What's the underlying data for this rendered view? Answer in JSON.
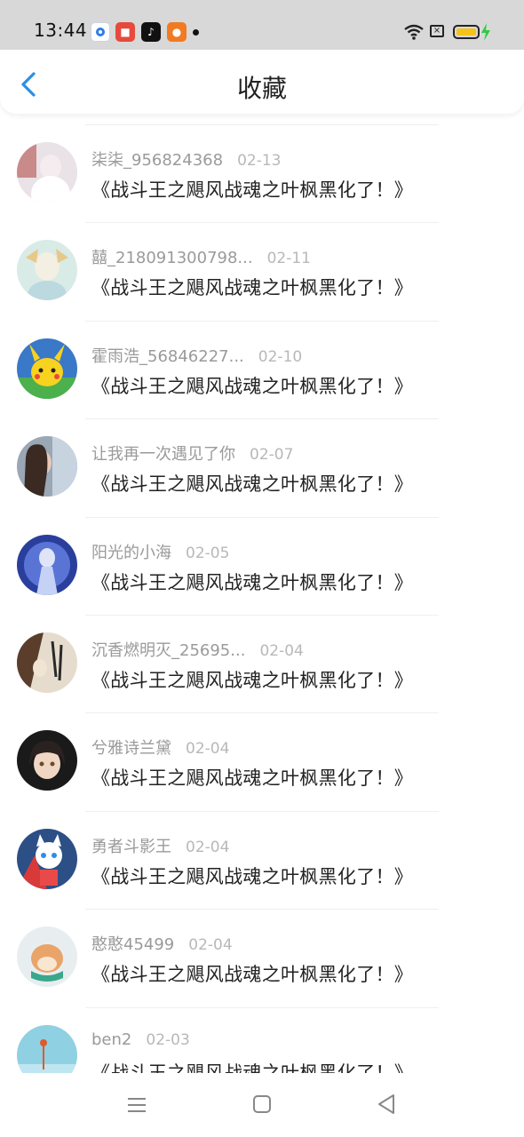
{
  "status_bar": {
    "time": "13:44"
  },
  "header": {
    "title": "收藏"
  },
  "items": [
    {
      "user": "柒柒_956824368",
      "date": "02-13",
      "title": "《战斗王之飓风战魂之叶枫黑化了！》"
    },
    {
      "user": "囍_218091300798...",
      "date": "02-11",
      "title": "《战斗王之飓风战魂之叶枫黑化了！》"
    },
    {
      "user": "霍雨浩_56846227...",
      "date": "02-10",
      "title": "《战斗王之飓风战魂之叶枫黑化了！》"
    },
    {
      "user": "让我再一次遇见了你",
      "date": "02-07",
      "title": "《战斗王之飓风战魂之叶枫黑化了！》"
    },
    {
      "user": "阳光的小海",
      "date": "02-05",
      "title": "《战斗王之飓风战魂之叶枫黑化了！》"
    },
    {
      "user": "沉香燃明灭_25695...",
      "date": "02-04",
      "title": "《战斗王之飓风战魂之叶枫黑化了！》"
    },
    {
      "user": "兮雅诗兰黛",
      "date": "02-04",
      "title": "《战斗王之飓风战魂之叶枫黑化了！》"
    },
    {
      "user": "勇者斗影王",
      "date": "02-04",
      "title": "《战斗王之飓风战魂之叶枫黑化了！》"
    },
    {
      "user": "憨憨45499",
      "date": "02-04",
      "title": "《战斗王之飓风战魂之叶枫黑化了！》"
    },
    {
      "user": "ben2",
      "date": "02-03",
      "title": "《战斗王之飓风战魂之叶枫黑化了！》"
    }
  ],
  "colors": {
    "accent": "#2a8fe6",
    "status_bar_bg": "#d8d8d8",
    "battery": "#f5c21a",
    "charging": "#2ecc40"
  },
  "icons": {
    "back": "chevron-left-icon",
    "wifi": "wifi-icon",
    "battery": "battery-icon",
    "nav_menu": "menu-icon",
    "nav_home": "home-square-icon",
    "nav_back": "triangle-back-icon"
  }
}
